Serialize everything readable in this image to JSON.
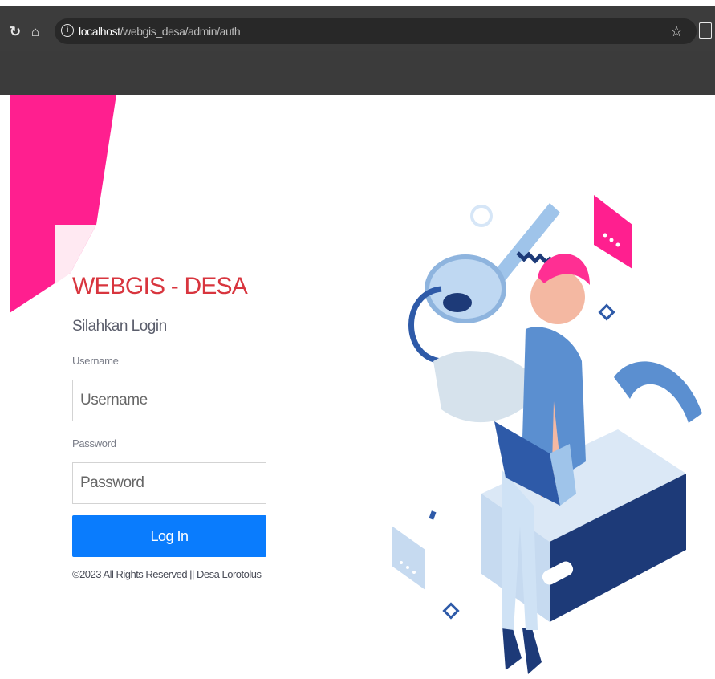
{
  "browser": {
    "url_host": "localhost",
    "url_path": "/webgis_desa/admin/auth",
    "reload_icon": "reload-icon",
    "home_icon": "home-icon",
    "info_icon": "info-icon",
    "star_icon": "star-icon",
    "extensions_icon": "extensions-icon"
  },
  "login": {
    "title": "WEBGIS - DESA",
    "subtitle": "Silahkan Login",
    "username_label": "Username",
    "username_placeholder": "Username",
    "username_value": "",
    "password_label": "Password",
    "password_placeholder": "Password",
    "password_value": "",
    "button_label": "Log In",
    "footer": "©2023 All Rights Reserved || Desa Lorotolus"
  },
  "colors": {
    "accent_pink": "#ff1f8f",
    "title_red": "#d8353e",
    "button_blue": "#0a7cfd",
    "illustration_blue": "#5b8fd0",
    "illustration_navy": "#1d3a78"
  }
}
